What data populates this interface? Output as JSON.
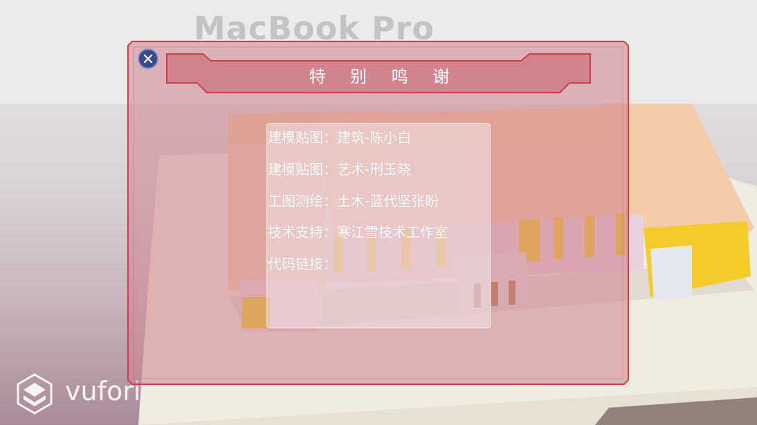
{
  "background": {
    "laptop_brand": "MacBook Pro",
    "vuforia_brand": "vufori"
  },
  "dialog": {
    "title": "特 别 鸣 谢",
    "close_icon": "close-icon",
    "credits": [
      {
        "role": "建模贴图",
        "name": "建筑-陈小白"
      },
      {
        "role": "建模贴图",
        "name": "艺术-刑玉晓"
      },
      {
        "role": "工图测绘",
        "name": "土木-蓝代坚张盼"
      },
      {
        "role": "技术支持",
        "name": "寒江雪技术工作室"
      },
      {
        "role": "代码链接",
        "name": ""
      }
    ],
    "separator": "：",
    "colors": {
      "frame": "#d03a48",
      "overlay": "rgba(205,130,140,0.55)",
      "close_button": "#3d4a8a"
    }
  }
}
